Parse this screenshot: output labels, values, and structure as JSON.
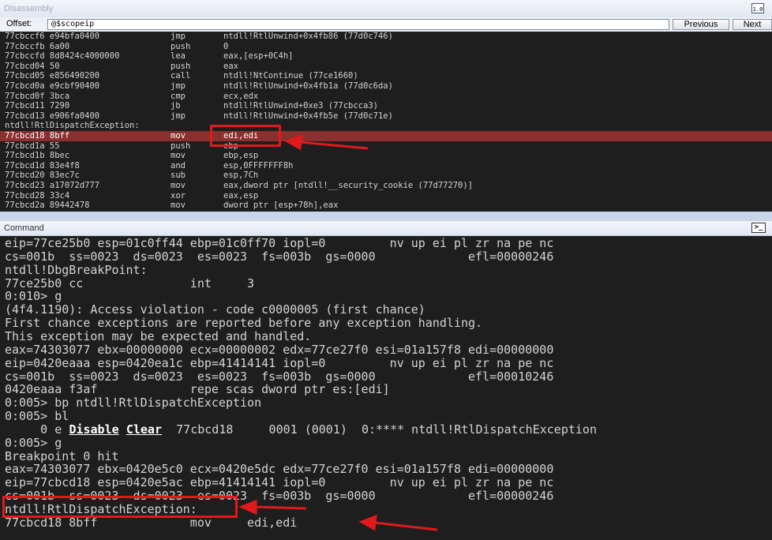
{
  "disassembly": {
    "title": "Disassembly",
    "offset_label": "Offset:",
    "offset_value": "@$scopeip",
    "previous_label": "Previous",
    "next_label": "Next",
    "window_icon": "disassembly-window-icon",
    "rows": [
      {
        "addr": "77cbccf6 e94bfa0400",
        "mnem": "jmp",
        "ops": "ntdll!RtlUnwind+0x4fb86 (77d0c746)"
      },
      {
        "addr": "77cbccfb 6a00",
        "mnem": "push",
        "ops": "0"
      },
      {
        "addr": "77cbccfd 8d8424c4000000",
        "mnem": "lea",
        "ops": "eax,[esp+0C4h]"
      },
      {
        "addr": "77cbcd04 50",
        "mnem": "push",
        "ops": "eax"
      },
      {
        "addr": "77cbcd05 e856490200",
        "mnem": "call",
        "ops": "ntdll!NtContinue (77ce1660)"
      },
      {
        "addr": "77cbcd0a e9cbf90400",
        "mnem": "jmp",
        "ops": "ntdll!RtlUnwind+0x4fb1a (77d0c6da)"
      },
      {
        "addr": "77cbcd0f 3bca",
        "mnem": "cmp",
        "ops": "ecx,edx"
      },
      {
        "addr": "77cbcd11 7290",
        "mnem": "jb",
        "ops": "ntdll!RtlUnwind+0xe3 (77cbcca3)"
      },
      {
        "addr": "77cbcd13 e906fa0400",
        "mnem": "jmp",
        "ops": "ntdll!RtlUnwind+0x4fb5e (77d0c71e)"
      },
      {
        "label": "ntdll!RtlDispatchException:"
      },
      {
        "addr": "77cbcd18 8bff",
        "mnem": "mov",
        "ops": "edi,edi",
        "current": true
      },
      {
        "addr": "77cbcd1a 55",
        "mnem": "push",
        "ops": "ebp"
      },
      {
        "addr": "77cbcd1b 8bec",
        "mnem": "mov",
        "ops": "ebp,esp"
      },
      {
        "addr": "77cbcd1d 83e4f8",
        "mnem": "and",
        "ops": "esp,0FFFFFFF8h"
      },
      {
        "addr": "77cbcd20 83ec7c",
        "mnem": "sub",
        "ops": "esp,7Ch"
      },
      {
        "addr": "77cbcd23 a17072d777",
        "mnem": "mov",
        "ops": "eax,dword ptr [ntdll!__security_cookie (77d77270)]"
      },
      {
        "addr": "77cbcd28 33c4",
        "mnem": "xor",
        "ops": "eax,esp"
      },
      {
        "addr": "77cbcd2a 89442478",
        "mnem": "mov",
        "ops": "dword ptr [esp+78h],eax"
      }
    ]
  },
  "command": {
    "title": "Command",
    "window_icon": "command-prompt-icon",
    "lines": [
      {
        "t": "eip=77ce25b0 esp=01c0ff44 ebp=01c0ff70 iopl=0         nv up ei pl zr na pe nc"
      },
      {
        "t": "cs=001b  ss=0023  ds=0023  es=0023  fs=003b  gs=0000             efl=00000246"
      },
      {
        "t": "ntdll!DbgBreakPoint:"
      },
      {
        "t": "77ce25b0 cc               int     3"
      },
      {
        "t": "0:010> g"
      },
      {
        "t": "(4f4.1190): Access violation - code c0000005 (first chance)"
      },
      {
        "t": "First chance exceptions are reported before any exception handling."
      },
      {
        "t": "This exception may be expected and handled."
      },
      {
        "t": "eax=74303077 ebx=00000000 ecx=00000002 edx=77ce27f0 esi=01a157f8 edi=00000000"
      },
      {
        "t": "eip=0420eaaa esp=0420ea1c ebp=41414141 iopl=0         nv up ei pl zr na pe nc"
      },
      {
        "t": "cs=001b  ss=0023  ds=0023  es=0023  fs=003b  gs=0000             efl=00010246"
      },
      {
        "t": "0420eaaa f3af             repe scas dword ptr es:[edi]"
      },
      {
        "t": "0:005> bp ntdll!RtlDispatchException"
      },
      {
        "t": "0:005> bl"
      },
      {
        "bp": true,
        "pre": "     0 e ",
        "disable": "Disable",
        "clear": "Clear",
        "post": "  77cbcd18     0001 (0001)  0:**** ntdll!RtlDispatchException"
      },
      {
        "t": "0:005> g"
      },
      {
        "t": "Breakpoint 0 hit"
      },
      {
        "t": "eax=74303077 ebx=0420e5c0 ecx=0420e5dc edx=77ce27f0 esi=01a157f8 edi=00000000"
      },
      {
        "t": "eip=77cbcd18 esp=0420e5ac ebp=41414141 iopl=0         nv up ei pl zr na pe nc"
      },
      {
        "t": "cs=001b  ss=0023  ds=0023  es=0023  fs=003b  gs=0000             efl=00000246"
      },
      {
        "t": "ntdll!RtlDispatchException:"
      },
      {
        "t": "77cbcd18 8bff             mov     edi,edi"
      }
    ]
  },
  "annotations": {
    "color": "#e0191c",
    "highlight_color": "#8b2f2f"
  }
}
